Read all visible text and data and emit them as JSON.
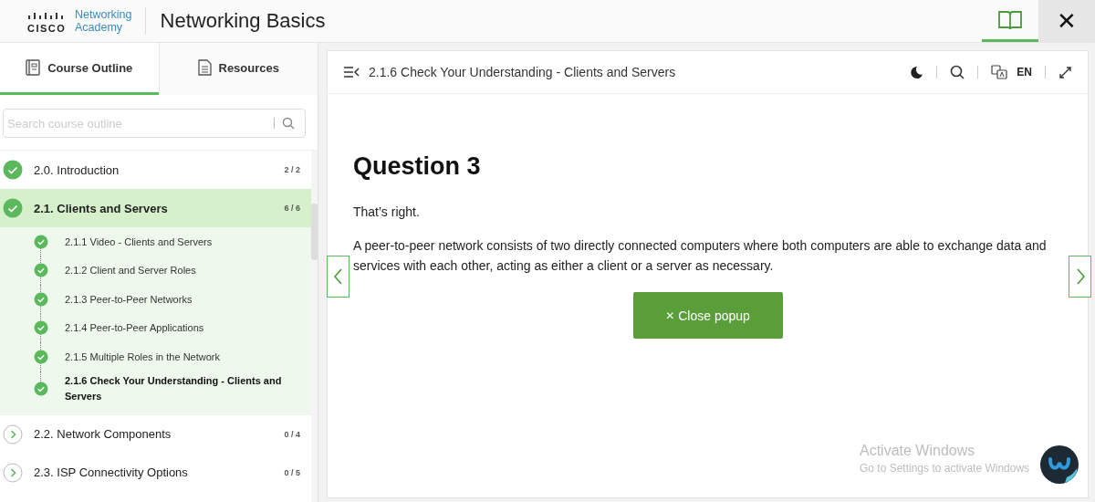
{
  "header": {
    "logo_top": "Networking",
    "logo_bottom": "Academy",
    "brand": "CISCO",
    "title": "Networking Basics",
    "book_tab": {
      "selected": true
    },
    "close": "✕"
  },
  "sidebar": {
    "tabs": [
      {
        "label": "Course Outline",
        "selected": true,
        "kind": "outline"
      },
      {
        "label": "Resources",
        "selected": false,
        "kind": "resources"
      }
    ],
    "search": {
      "placeholder": "Search course outline"
    },
    "modules": [
      {
        "label": "2.0. Introduction",
        "count": "2 / 2",
        "done": true,
        "selected": false
      },
      {
        "label": "2.1. Clients and Servers",
        "count": "6 / 6",
        "done": true,
        "selected": true,
        "children": [
          {
            "label": "2.1.1 Video - Clients and Servers",
            "done": true,
            "selected": false
          },
          {
            "label": "2.1.2 Client and Server Roles",
            "done": true,
            "selected": false
          },
          {
            "label": "2.1.3 Peer-to-Peer Networks",
            "done": true,
            "selected": false
          },
          {
            "label": "2.1.4 Peer-to-Peer Applications",
            "done": true,
            "selected": false
          },
          {
            "label": "2.1.5 Multiple Roles in the Network",
            "done": true,
            "selected": false
          },
          {
            "label": "2.1.6 Check Your Understanding - Clients and Servers",
            "done": true,
            "selected": true
          }
        ]
      },
      {
        "label": "2.2. Network Components",
        "count": "0 / 4",
        "done": false,
        "selected": false
      },
      {
        "label": "2.3. ISP Connectivity Options",
        "count": "0 / 5",
        "done": false,
        "selected": false
      }
    ]
  },
  "main": {
    "title": "2.1.6 Check Your Understanding - Clients and Servers",
    "language": "EN",
    "question": "Question 3",
    "feedback": "That’s right.",
    "explanation": "A peer-to-peer network consists of two directly connected computers where both computers are able to exchange data and services with each other, acting as either a client or a server as necessary.",
    "close_icon": "✕",
    "close_label": "Close popup"
  },
  "overlay": {
    "title": "Activate Windows",
    "subtitle": "Go to Settings to activate Windows"
  }
}
